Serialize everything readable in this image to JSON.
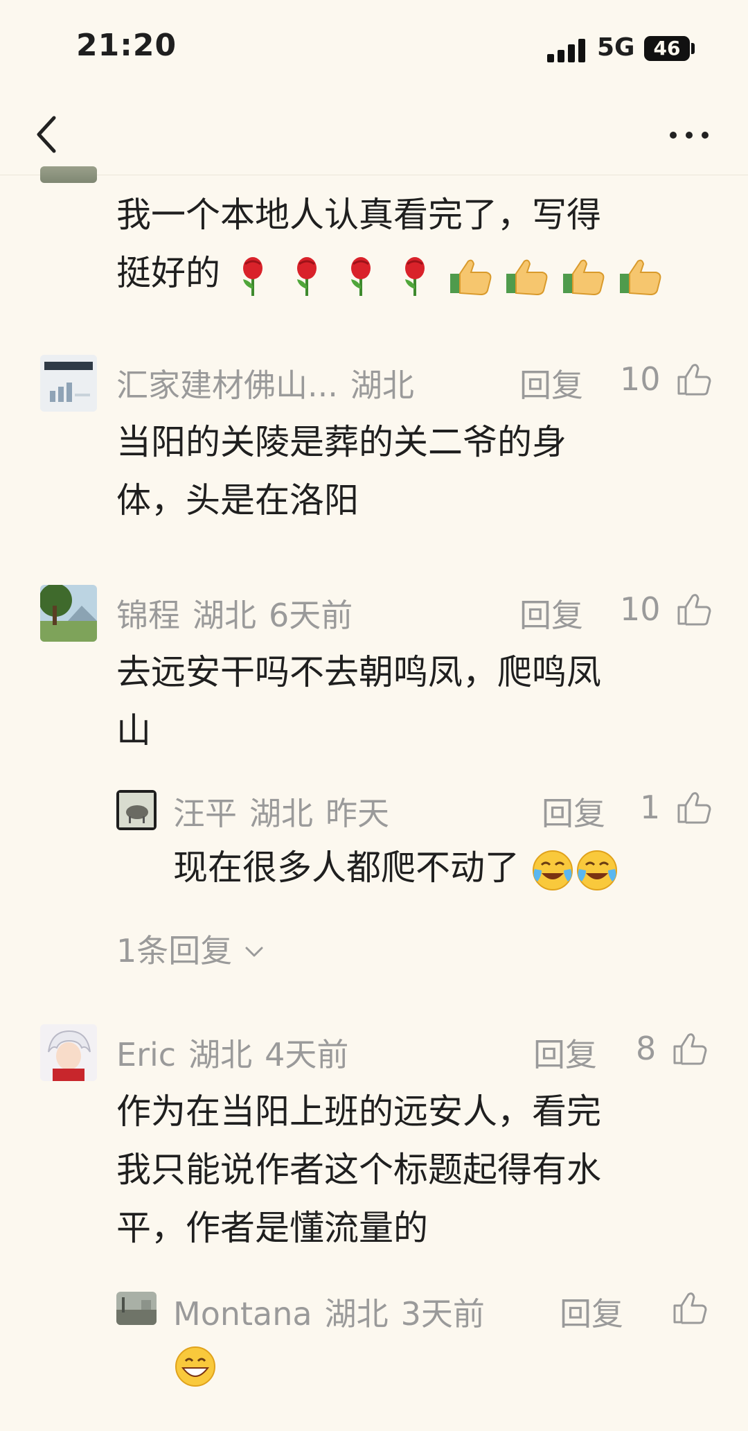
{
  "status_bar": {
    "time": "21:20",
    "network": "5G",
    "battery": "46"
  },
  "comments": [
    {
      "text_line1": "我一个本地人认真看完了，写得",
      "text_line2": "挺好的",
      "emojis": [
        "rose",
        "rose",
        "rose",
        "rose",
        "thumbs-up",
        "thumbs-up",
        "thumbs-up",
        "thumbs-up"
      ]
    },
    {
      "user": "汇家建材佛山...",
      "location": "湖北",
      "reply_label": "回复",
      "likes": "10",
      "text_line1": "当阳的关陵是葬的关二爷的身",
      "text_line2": "体，头是在洛阳"
    },
    {
      "user": "锦程",
      "location": "湖北",
      "time": "6天前",
      "reply_label": "回复",
      "likes": "10",
      "text_line1": "去远安干吗不去朝鸣凤，爬鸣凤",
      "text_line2": "山",
      "reply": {
        "user": "汪平",
        "location": "湖北",
        "time": "昨天",
        "reply_label": "回复",
        "likes": "1",
        "text": "现在很多人都爬不动了",
        "emojis": [
          "crying-laughing",
          "crying-laughing"
        ]
      },
      "more_replies": "1条回复"
    },
    {
      "user": "Eric",
      "location": "湖北",
      "time": "4天前",
      "reply_label": "回复",
      "likes": "8",
      "text_line1": "作为在当阳上班的远安人，看完",
      "text_line2": "我只能说作者这个标题起得有水",
      "text_line3": "平，作者是懂流量的",
      "reply": {
        "user": "Montana",
        "location": "湖北",
        "time": "3天前",
        "reply_label": "回复",
        "emojis": [
          "grinning-face"
        ]
      }
    }
  ]
}
